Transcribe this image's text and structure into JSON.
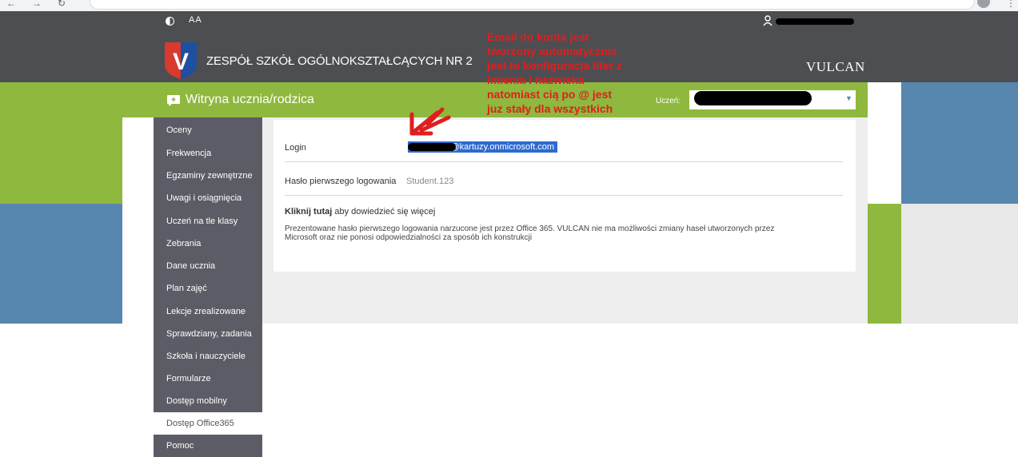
{
  "header": {
    "contrast_icon": "contrast-icon",
    "font_size_label": "AA",
    "school_name": "ZESPÓŁ SZKÓŁ OGÓLNOKSZTAŁCĄCYCH NR 2",
    "logo_letter": "V",
    "brand": "VULCAN",
    "user_icon": "user-icon"
  },
  "portal": {
    "title": "Witryna ucznia/rodzica",
    "student_label": "Uczeń:",
    "colors": {
      "green": "#8fb83e",
      "blue": "#5787ae",
      "dark": "#4d4e52",
      "sidebar": "#5c5c66",
      "annotation": "#e01e1e",
      "selection": "#2e6ad0"
    }
  },
  "sidebar": {
    "items": [
      {
        "label": "Oceny"
      },
      {
        "label": "Frekwencja"
      },
      {
        "label": "Egzaminy zewnętrzne"
      },
      {
        "label": "Uwagi i osiągnięcia"
      },
      {
        "label": "Uczeń na tle klasy"
      },
      {
        "label": "Zebrania"
      },
      {
        "label": "Dane ucznia"
      },
      {
        "label": "Plan zajęć"
      },
      {
        "label": "Lekcje zrealizowane"
      },
      {
        "label": "Sprawdziany, zadania"
      },
      {
        "label": "Szkoła i nauczyciele"
      },
      {
        "label": "Formularze"
      },
      {
        "label": "Dostęp mobilny"
      },
      {
        "label": "Dostęp Office365",
        "active": true
      },
      {
        "label": "Pomoc"
      }
    ]
  },
  "content": {
    "login_label": "Login",
    "login_value": "k@kartuzy.onmicrosoft.com",
    "password_label": "Hasło pierwszego logowania",
    "password_value": "Student.123",
    "click_here": "Kliknij tutaj",
    "click_here_rest": " aby dowiedzieć się więcej",
    "info_line1": "Prezentowane hasło pierwszego logowania narzucone jest przez Office 365. VULCAN nie ma możliwości zmiany haseł utworzonych przez",
    "info_line2": "Microsoft oraz nie ponosi odpowiedzialności za sposób ich konstrukcji"
  },
  "annotation": {
    "lines": [
      "Email do konta jest",
      "tworzony automatycznie",
      "jest to konfiguracja liter z",
      "imienia i nazwiska",
      "natomiast cią po @ jest",
      "juz stały dla wszystkich"
    ]
  }
}
